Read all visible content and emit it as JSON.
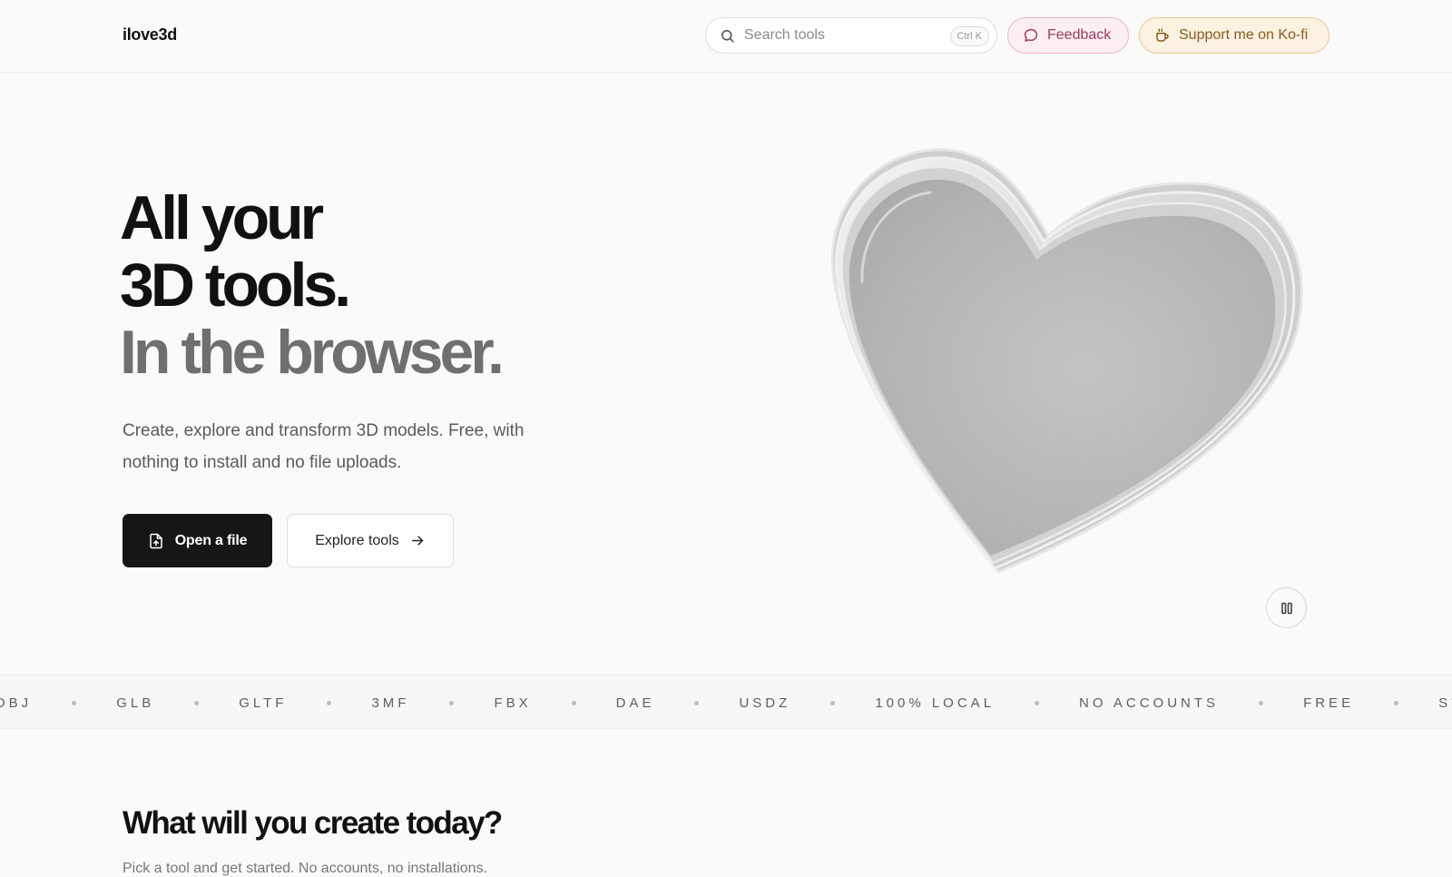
{
  "header": {
    "logo": "ilove3d",
    "search": {
      "placeholder": "Search tools",
      "shortcut": "Ctrl K"
    },
    "feedback_label": "Feedback",
    "kofi_label": "Support me on Ko-fi"
  },
  "hero": {
    "line1": "All your",
    "line2": "3D tools.",
    "line3": "In the browser.",
    "subtitle": "Create, explore and transform 3D models. Free, with nothing to install and no file uploads.",
    "primary_label": "Open a file",
    "secondary_label": "Explore tools"
  },
  "marquee": {
    "items": [
      "OBJ",
      "GLB",
      "GLTF",
      "3MF",
      "FBX",
      "DAE",
      "USDZ",
      "100% LOCAL",
      "NO ACCOUNTS",
      "FREE",
      "STL"
    ]
  },
  "section": {
    "title": "What will you create today?",
    "subtitle": "Pick a tool and get started. No accounts, no installations."
  },
  "icons": {
    "search": "search-icon",
    "feedback": "chat-bubble-icon",
    "kofi": "coffee-cup-icon",
    "open_file": "file-upload-icon",
    "explore": "arrow-right-icon",
    "pause": "pause-icon",
    "hero": "heart-3d-icon"
  },
  "colors": {
    "primary_button": "#161616",
    "feedback_bg": "#fdeef2",
    "feedback_border": "#efb4c3",
    "kofi_bg": "#fdf1e2",
    "kofi_border": "#efc88f",
    "hero_gray": "#6f6f6f"
  }
}
